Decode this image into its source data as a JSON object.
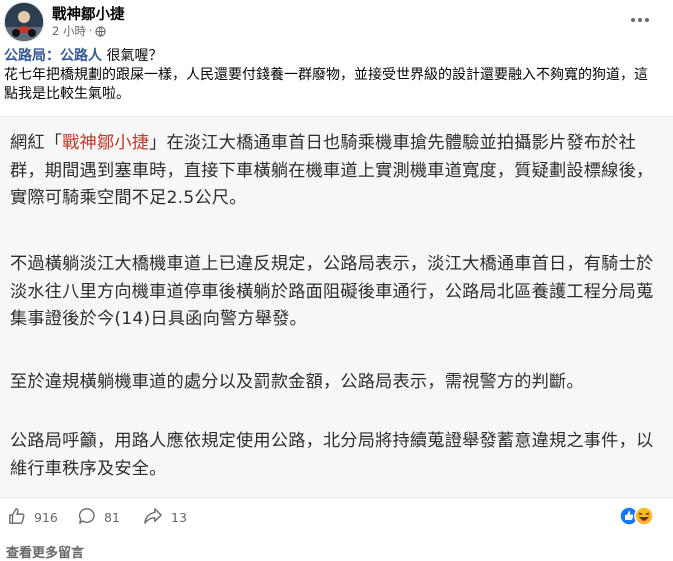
{
  "post": {
    "author": "戰神鄒小捷",
    "time": "2 小時",
    "dot": "·",
    "avatar": "avatar",
    "caption_tag": "公路局：公路人",
    "caption_rest": " 很氣喔？",
    "caption_line2": "花七年把橋規劃的跟屎一樣，人民還要付錢養一群廢物，並接受世界級的設計還要融入不夠寬的狗道，這點我是比較生氣啦。"
  },
  "article": {
    "p1_pre": "網紅「",
    "p1_hl": "戰神鄒小捷",
    "p1_post": "」在淡江大橋通車首日也騎乘機車搶先體驗並拍攝影片發布於社群，期間遇到塞車時，直接下車橫躺在機車道上實測機車道寬度，質疑劃設標線後，實際可騎乘空間不足2.5公尺。",
    "p2": "不過橫躺淡江大橋機車道上已違反規定，公路局表示，淡江大橋通車首日，有騎士於淡水往八里方向機車道停車後橫躺於路面阻礙後車通行，公路局北區養護工程分局蒐集事證後於今(14)日具函向警方舉發。",
    "p3": "至於違規橫躺機車道的處分以及罰款金額，公路局表示，需視警方的判斷。",
    "p4": "公路局呼籲，用路人應依規定使用公路，北分局將持續蒐證舉發蓄意違規之事件，以維行車秩序及安全。"
  },
  "stats": {
    "likes": "916",
    "comments": "81",
    "shares": "13"
  },
  "footer": {
    "more_comments": "查看更多留言"
  },
  "colors": {
    "tag": "#385898",
    "highlight": "#c0392b",
    "like_blue": "#1877f2",
    "haha_yellow": "#f7b928"
  },
  "icons": [
    "globe-icon",
    "more-icon",
    "like-icon",
    "comment-icon",
    "share-icon",
    "like-reaction-icon",
    "haha-reaction-icon"
  ]
}
